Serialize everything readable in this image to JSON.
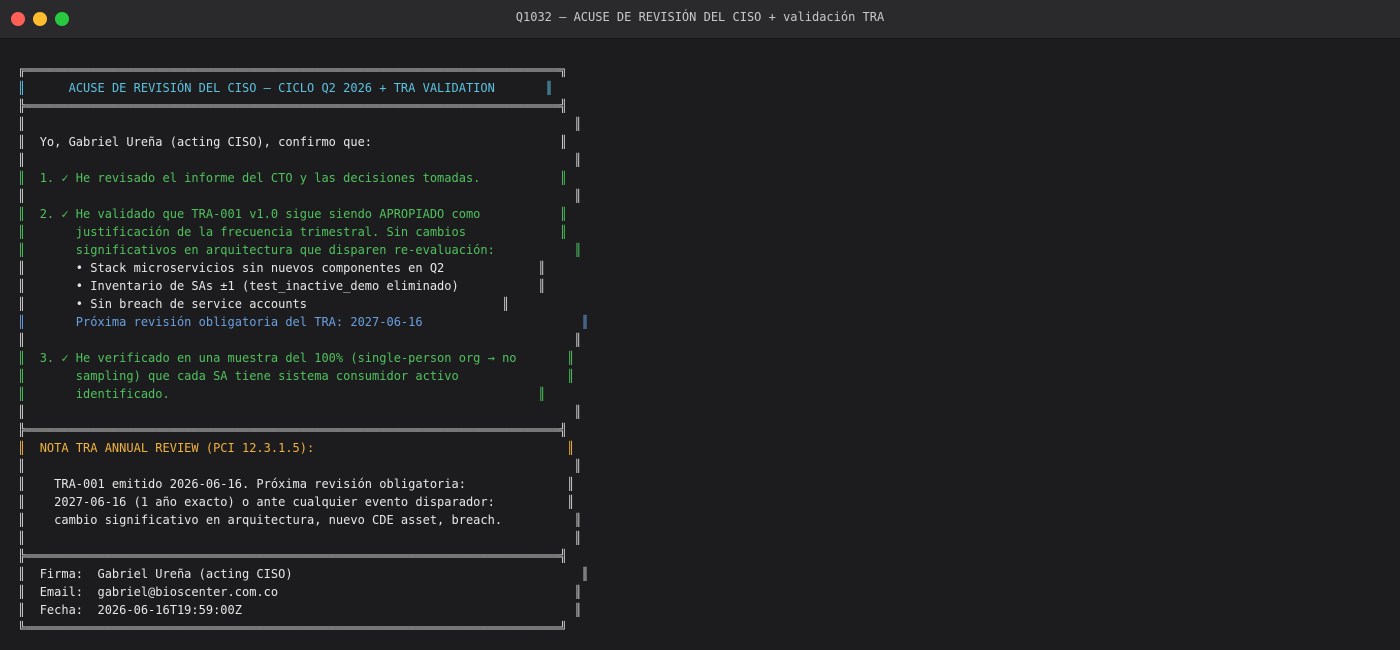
{
  "window": {
    "title": "Q1032 — ACUSE DE REVISIÓN DEL CISO + validación TRA"
  },
  "doc": {
    "header": "ACUSE DE REVISIÓN DEL CISO — CICLO Q2 2026 + TRA VALIDATION",
    "intro": "Yo, Gabriel Ureña (acting CISO), confirmo que:",
    "item1": "1. ✓ He revisado el informe del CTO y las decisiones tomadas.",
    "item2": [
      "2. ✓ He validado que TRA-001 v1.0 sigue siendo APROPIADO como",
      "     justificación de la frecuencia trimestral. Sin cambios",
      "     significativos en arquitectura que disparen re-evaluación:"
    ],
    "bullets": [
      "     • Stack microservicios sin nuevos componentes en Q2",
      "     • Inventario de SAs ±1 (test_inactive_demo eliminado)",
      "     • Sin breach de service accounts"
    ],
    "next_review": "     Próxima revisión obligatoria del TRA: 2027-06-16",
    "item3": [
      "3. ✓ He verificado en una muestra del 100% (single-person org → no",
      "     sampling) que cada SA tiene sistema consumidor activo",
      "     identificado."
    ],
    "nota_title": "NOTA TRA ANNUAL REVIEW (PCI 12.3.1.5):",
    "nota_lines": [
      "  TRA-001 emitido 2026-06-16. Próxima revisión obligatoria:",
      "  2027-06-16 (1 año exacto) o ante cualquier evento disparador:",
      "  cambio significativo en arquitectura, nuevo CDE asset, breach."
    ],
    "firma": "Firma:  Gabriel Ureña (acting CISO)",
    "email": "Email:  gabriel@bioscenter.com.co",
    "fecha": "Fecha:  2026-06-16T19:59:00Z"
  }
}
